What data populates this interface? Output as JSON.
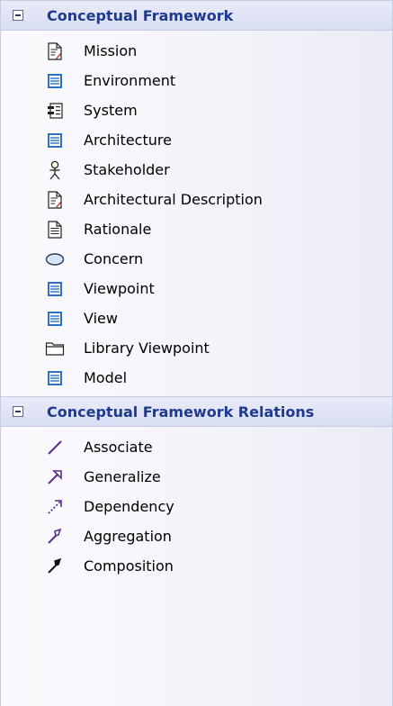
{
  "sections": [
    {
      "title": "Conceptual Framework",
      "items": [
        {
          "label": "Mission",
          "icon": "document-artifact-icon"
        },
        {
          "label": "Environment",
          "icon": "class-element-icon"
        },
        {
          "label": "System",
          "icon": "component-icon"
        },
        {
          "label": "Architecture",
          "icon": "class-element-icon"
        },
        {
          "label": "Stakeholder",
          "icon": "actor-icon"
        },
        {
          "label": "Architectural Description",
          "icon": "document-artifact-icon"
        },
        {
          "label": "Rationale",
          "icon": "document-icon"
        },
        {
          "label": "Concern",
          "icon": "use-case-ellipse-icon"
        },
        {
          "label": "Viewpoint",
          "icon": "class-element-icon"
        },
        {
          "label": "View",
          "icon": "class-element-icon"
        },
        {
          "label": "Library Viewpoint",
          "icon": "package-folder-icon"
        },
        {
          "label": "Model",
          "icon": "class-element-icon"
        }
      ]
    },
    {
      "title": "Conceptual Framework Relations",
      "items": [
        {
          "label": "Associate",
          "icon": "associate-line-icon"
        },
        {
          "label": "Generalize",
          "icon": "generalize-arrow-icon"
        },
        {
          "label": "Dependency",
          "icon": "dependency-arrow-icon"
        },
        {
          "label": "Aggregation",
          "icon": "aggregation-arrow-icon"
        },
        {
          "label": "Composition",
          "icon": "composition-arrow-icon"
        }
      ]
    }
  ],
  "colors": {
    "header_text": "#1e3a8c",
    "header_bg": "#dde1f4",
    "icon_blue": "#2f6fc6",
    "icon_purple": "#5b2d8c"
  }
}
